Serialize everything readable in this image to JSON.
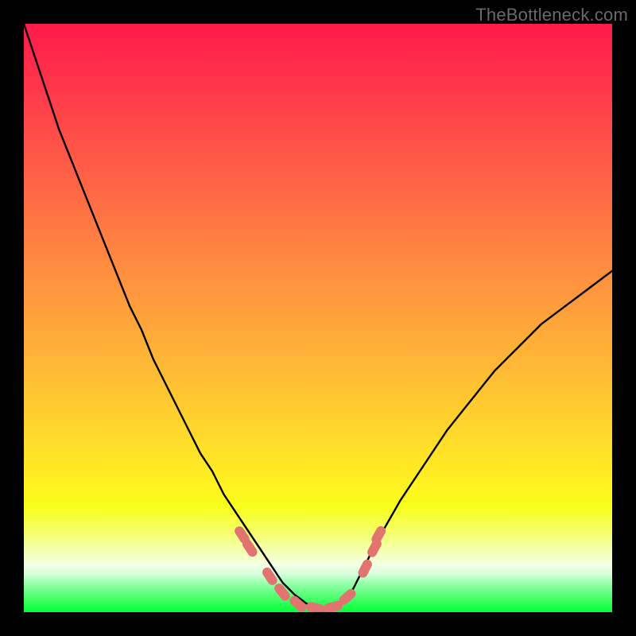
{
  "watermark": "TheBottleneck.com",
  "colors": {
    "frame": "#000000",
    "curve": "#000000",
    "marker": "#e2746f",
    "gradient_stops": [
      [
        "0%",
        "#ff1b4a"
      ],
      [
        "79%",
        "#fff31f"
      ],
      [
        "92%",
        "#f3ffe4"
      ],
      [
        "100%",
        "#05ff37"
      ]
    ]
  },
  "chart_data": {
    "type": "line",
    "title": "",
    "xlabel": "",
    "ylabel": "",
    "xlim": [
      0,
      100
    ],
    "ylim": [
      0,
      100
    ],
    "grid": false,
    "legend": false,
    "series": [
      {
        "name": "bottleneck-curve",
        "x": [
          0,
          2,
          4,
          6,
          8,
          10,
          12,
          14,
          16,
          18,
          20,
          22,
          24,
          26,
          28,
          30,
          32,
          34,
          36,
          38,
          40,
          42,
          44,
          46,
          48,
          50,
          52,
          54,
          56,
          58,
          60,
          64,
          68,
          72,
          76,
          80,
          84,
          88,
          92,
          96,
          100
        ],
        "y": [
          100,
          94,
          88,
          82,
          77,
          72,
          67,
          62,
          57,
          52,
          48,
          43,
          39,
          35,
          31,
          27,
          24,
          20,
          17,
          14,
          11,
          8,
          5,
          3,
          1.5,
          0.5,
          0.5,
          1.5,
          4,
          8,
          12,
          19,
          25,
          31,
          36,
          41,
          45,
          49,
          52,
          55,
          58
        ]
      }
    ],
    "markers": [
      {
        "x": 37.1,
        "y": 13.1
      },
      {
        "x": 38.4,
        "y": 10.9
      },
      {
        "x": 41.8,
        "y": 6.1
      },
      {
        "x": 43.9,
        "y": 3.4
      },
      {
        "x": 46.6,
        "y": 1.4
      },
      {
        "x": 49.6,
        "y": 0.7
      },
      {
        "x": 52.6,
        "y": 0.9
      },
      {
        "x": 55.0,
        "y": 2.6
      },
      {
        "x": 58.0,
        "y": 7.4
      },
      {
        "x": 59.6,
        "y": 10.9
      },
      {
        "x": 60.3,
        "y": 13.1
      }
    ]
  }
}
